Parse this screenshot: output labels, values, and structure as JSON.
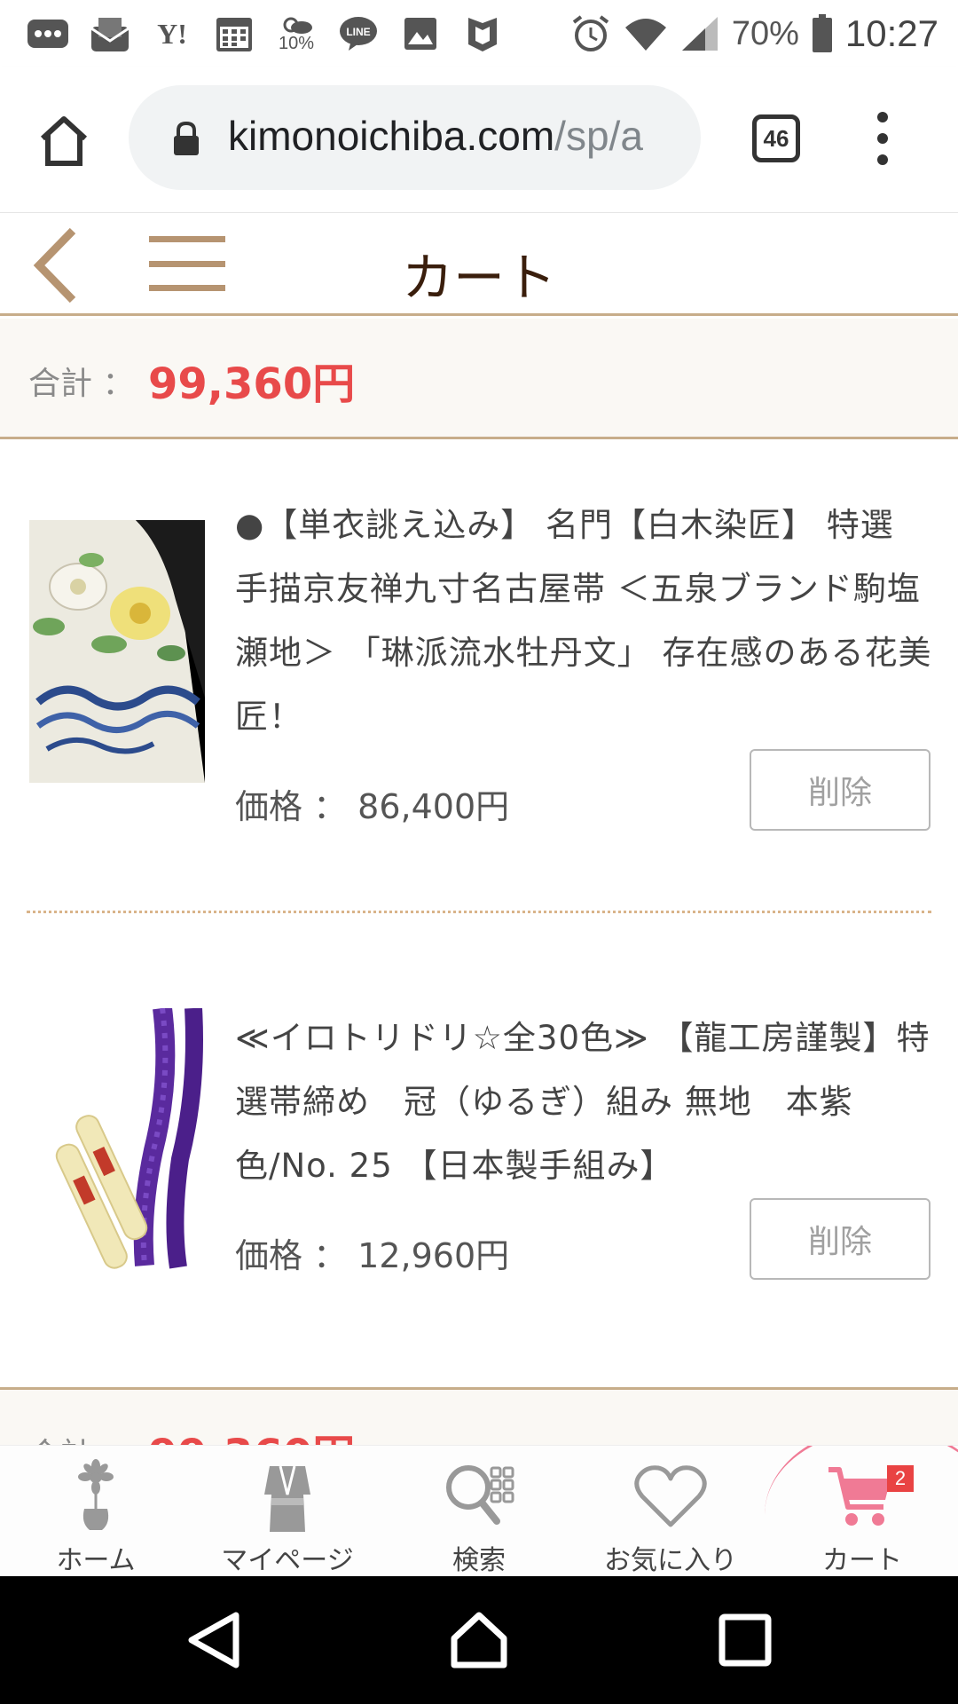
{
  "status_bar": {
    "notification_icons": [
      "more-icon",
      "mail-icon",
      "yahoo-icon",
      "calendar-icon",
      "weather-icon",
      "line-icon",
      "gallery-icon",
      "shield-icon"
    ],
    "weather_pct": "10%",
    "yahoo_text": "Y!",
    "line_text": "LINE",
    "battery": "70%",
    "time": "10:27"
  },
  "browser": {
    "url_main": "kimonoichiba.com",
    "url_path": "/sp/a",
    "tab_count": "46"
  },
  "header": {
    "title": "カート"
  },
  "summary": {
    "total_label": "合計 ：",
    "total_value": "99,360円"
  },
  "cart_items": [
    {
      "title": "●【単衣誂え込み】 名門【白木染匠】 特選 手描京友禅九寸名古屋帯 ＜五泉ブランド駒塩瀬地＞ 「琳派流水牡丹文」 存在感のある花美匠！",
      "price": "価格 ： 86,400円",
      "delete_label": "削除"
    },
    {
      "title": "≪イロトリドリ☆全30色≫ 【龍工房謹製】特選帯締め　冠（ゆるぎ）組み 無地　本紫色/No. 25 【日本製手組み】",
      "price": "価格 ： 12,960円",
      "delete_label": "削除"
    }
  ],
  "bottom_nav": {
    "items": [
      {
        "label": "ホーム",
        "icon": "flower-vase-icon"
      },
      {
        "label": "マイページ",
        "icon": "kimono-icon"
      },
      {
        "label": "検索",
        "icon": "search-grid-icon"
      },
      {
        "label": "お気に入り",
        "icon": "heart-icon"
      },
      {
        "label": "カート",
        "icon": "cart-icon"
      }
    ],
    "cart_badge": "2"
  },
  "colors": {
    "accent_brown": "#b69471",
    "price_red": "#e84a4a",
    "cart_pink": "#f07a95"
  }
}
